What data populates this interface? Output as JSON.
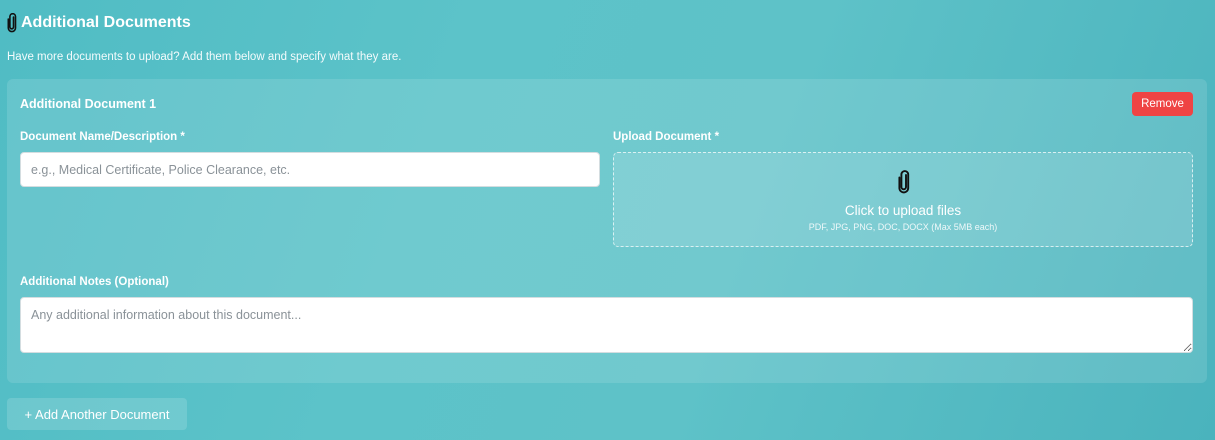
{
  "section": {
    "icon": "paperclip-icon",
    "title": "Additional Documents",
    "subtitle": "Have more documents to upload? Add them below and specify what they are."
  },
  "documents": [
    {
      "title": "Additional Document 1",
      "remove_label": "Remove",
      "name_label": "Document Name/Description *",
      "name_value": "",
      "name_placeholder": "e.g., Medical Certificate, Police Clearance, etc.",
      "upload_label": "Upload Document *",
      "upload_icon": "paperclip-icon",
      "upload_text": "Click to upload files",
      "upload_hint": "PDF, JPG, PNG, DOC, DOCX (Max 5MB each)",
      "notes_label": "Additional Notes (Optional)",
      "notes_value": "",
      "notes_placeholder": "Any additional information about this document..."
    }
  ],
  "add_button_label": "+ Add Another Document",
  "colors": {
    "remove_button": "#ef4444",
    "background": "#56bec6"
  }
}
